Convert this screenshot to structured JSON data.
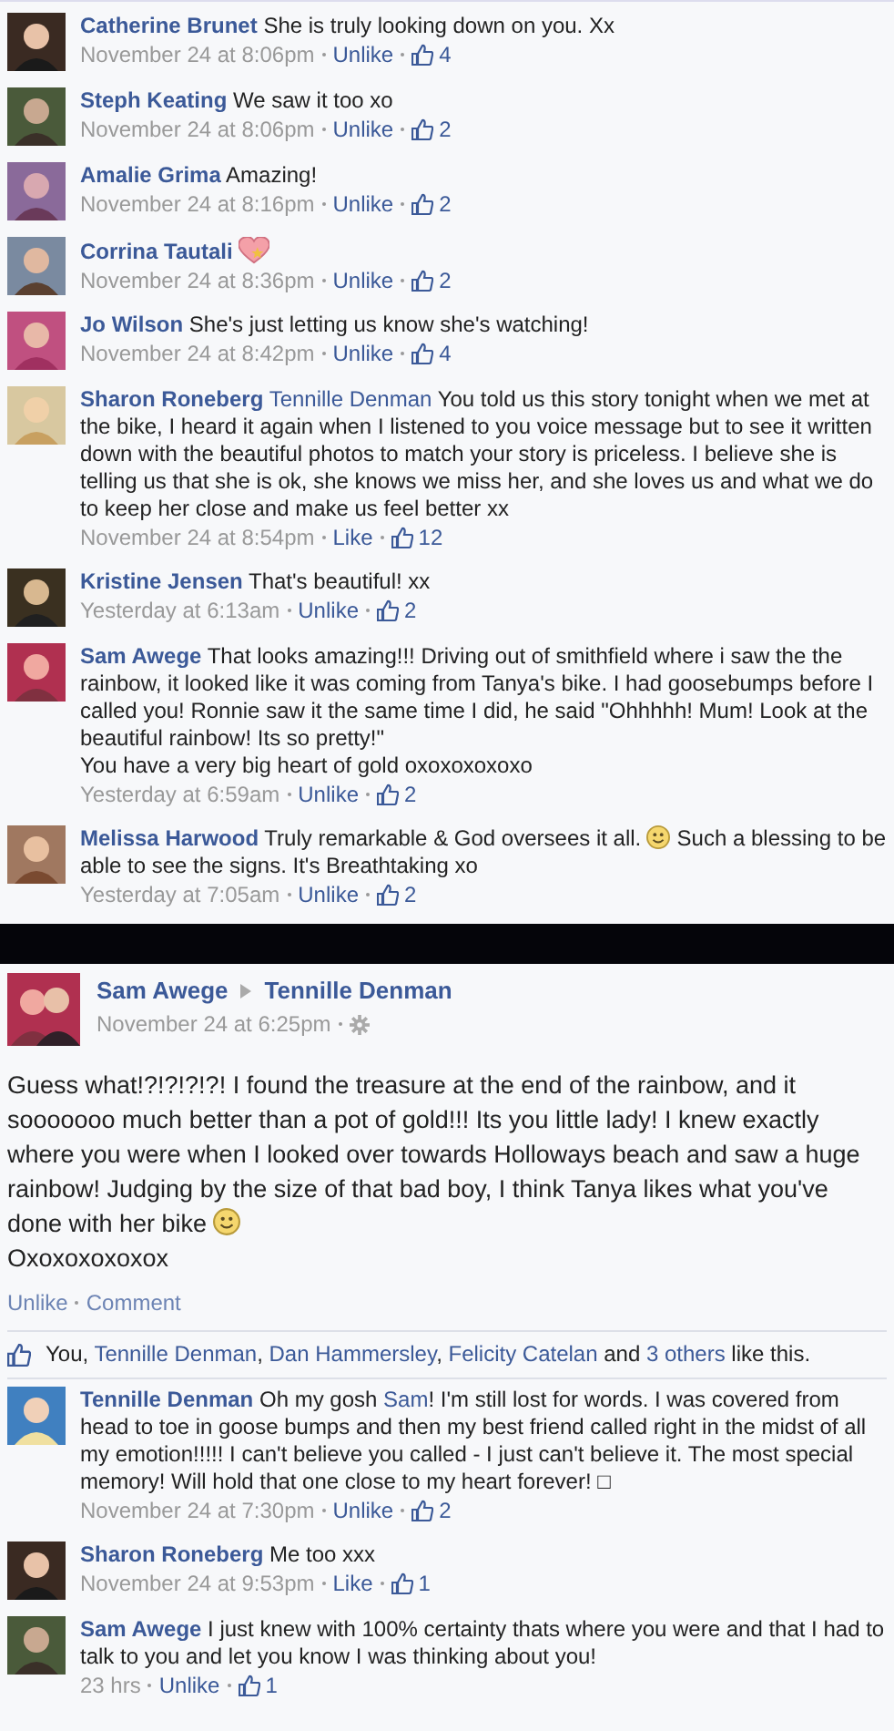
{
  "top_comments": [
    {
      "author": "Catherine Brunet",
      "parts": [
        {
          "kind": "text",
          "text": "She is truly looking down on you. Xx"
        }
      ],
      "time": "November 24 at 8:06pm",
      "action": "Unlike",
      "likes": "4"
    },
    {
      "author": "Steph Keating",
      "parts": [
        {
          "kind": "text",
          "text": "We saw it too xo"
        }
      ],
      "time": "November 24 at 8:06pm",
      "action": "Unlike",
      "likes": "2"
    },
    {
      "author": "Amalie Grima",
      "parts": [
        {
          "kind": "text",
          "text": "Amazing!"
        }
      ],
      "time": "November 24 at 8:16pm",
      "action": "Unlike",
      "likes": "2"
    },
    {
      "author": "Corrina Tautali",
      "parts": [
        {
          "kind": "heart"
        }
      ],
      "time": "November 24 at 8:36pm",
      "action": "Unlike",
      "likes": "2"
    },
    {
      "author": "Jo Wilson",
      "parts": [
        {
          "kind": "text",
          "text": "She's just letting us know she's watching!"
        }
      ],
      "time": "November 24 at 8:42pm",
      "action": "Unlike",
      "likes": "4"
    },
    {
      "author": "Sharon Roneberg",
      "parts": [
        {
          "kind": "link",
          "text": "Tennille Denman"
        },
        {
          "kind": "text",
          "text": " You told us this story tonight when we met at the bike, I heard it again when I listened to you voice message but to see it written down with the beautiful photos to match your story is priceless. I believe she is telling us that she is ok, she knows we miss her, and she loves us and what we do to keep her close and make us feel better xx"
        }
      ],
      "time": "November 24 at 8:54pm",
      "action": "Like",
      "likes": "12"
    },
    {
      "author": "Kristine Jensen",
      "parts": [
        {
          "kind": "text",
          "text": "That's beautiful! xx"
        }
      ],
      "time": "Yesterday at 6:13am",
      "action": "Unlike",
      "likes": "2"
    },
    {
      "author": "Sam Awege",
      "parts": [
        {
          "kind": "text",
          "text": "That looks amazing!!! Driving out of smithfield where i saw the the rainbow, it looked like it was coming from Tanya's bike. I had goosebumps before I called you! Ronnie saw it the same time I did, he said \"Ohhhhh! Mum! Look at the beautiful rainbow! Its so pretty!\"\nYou have a very big heart of gold oxoxoxoxoxo"
        }
      ],
      "time": "Yesterday at 6:59am",
      "action": "Unlike",
      "likes": "2"
    },
    {
      "author": "Melissa Harwood",
      "parts": [
        {
          "kind": "text",
          "text": "Truly remarkable & God oversees it all. "
        },
        {
          "kind": "smiley"
        },
        {
          "kind": "text",
          "text": " Such a blessing to be able to see the signs. It's Breathtaking xo"
        }
      ],
      "time": "Yesterday at 7:05am",
      "action": "Unlike",
      "likes": "2"
    }
  ],
  "post": {
    "author": "Sam Awege",
    "target": "Tennille Denman",
    "time": "November 24 at 6:25pm",
    "parts": [
      {
        "kind": "text",
        "text": "Guess what!?!?!?!?! I found the treasure at the end of the rainbow, and it sooooooo much better than a pot of gold!!! Its you little lady! I knew exactly where you were when I looked over towards Holloways beach and saw a huge rainbow! Judging by the size of that bad boy, I think Tanya likes what you've done with her bike "
      },
      {
        "kind": "smiley"
      },
      {
        "kind": "text",
        "text": "\nOxoxoxoxoxox"
      }
    ],
    "actions": [
      "Unlike",
      "Comment"
    ]
  },
  "likes_line": [
    {
      "kind": "text",
      "text": "You, "
    },
    {
      "kind": "link",
      "text": "Tennille Denman"
    },
    {
      "kind": "text",
      "text": ", "
    },
    {
      "kind": "link",
      "text": "Dan Hammersley"
    },
    {
      "kind": "text",
      "text": ", "
    },
    {
      "kind": "link",
      "text": "Felicity Catelan"
    },
    {
      "kind": "text",
      "text": " and "
    },
    {
      "kind": "link",
      "text": "3 others"
    },
    {
      "kind": "text",
      "text": " like this."
    }
  ],
  "comments": [
    {
      "author": "Tennille Denman",
      "parts": [
        {
          "kind": "text",
          "text": "Oh my gosh "
        },
        {
          "kind": "link",
          "text": "Sam"
        },
        {
          "kind": "text",
          "text": "! I'm still lost for words. I was covered from head to toe in goose bumps and then my best friend called right in the midst of all my emotion!!!!! I can't believe you called - I just can't believe it. The most special memory! Will hold that one close to my heart forever! □"
        }
      ],
      "time": "November 24 at 7:30pm",
      "action": "Unlike",
      "likes": "2"
    },
    {
      "author": "Sharon Roneberg",
      "parts": [
        {
          "kind": "text",
          "text": "Me too xxx"
        }
      ],
      "time": "November 24 at 9:53pm",
      "action": "Like",
      "likes": "1"
    },
    {
      "author": "Sam Awege",
      "parts": [
        {
          "kind": "text",
          "text": "I just knew with 100% certainty thats where you were and that I had to talk to you and let you know I was thinking about you!"
        }
      ],
      "time": "23 hrs",
      "action": "Unlike",
      "likes": "1"
    }
  ]
}
